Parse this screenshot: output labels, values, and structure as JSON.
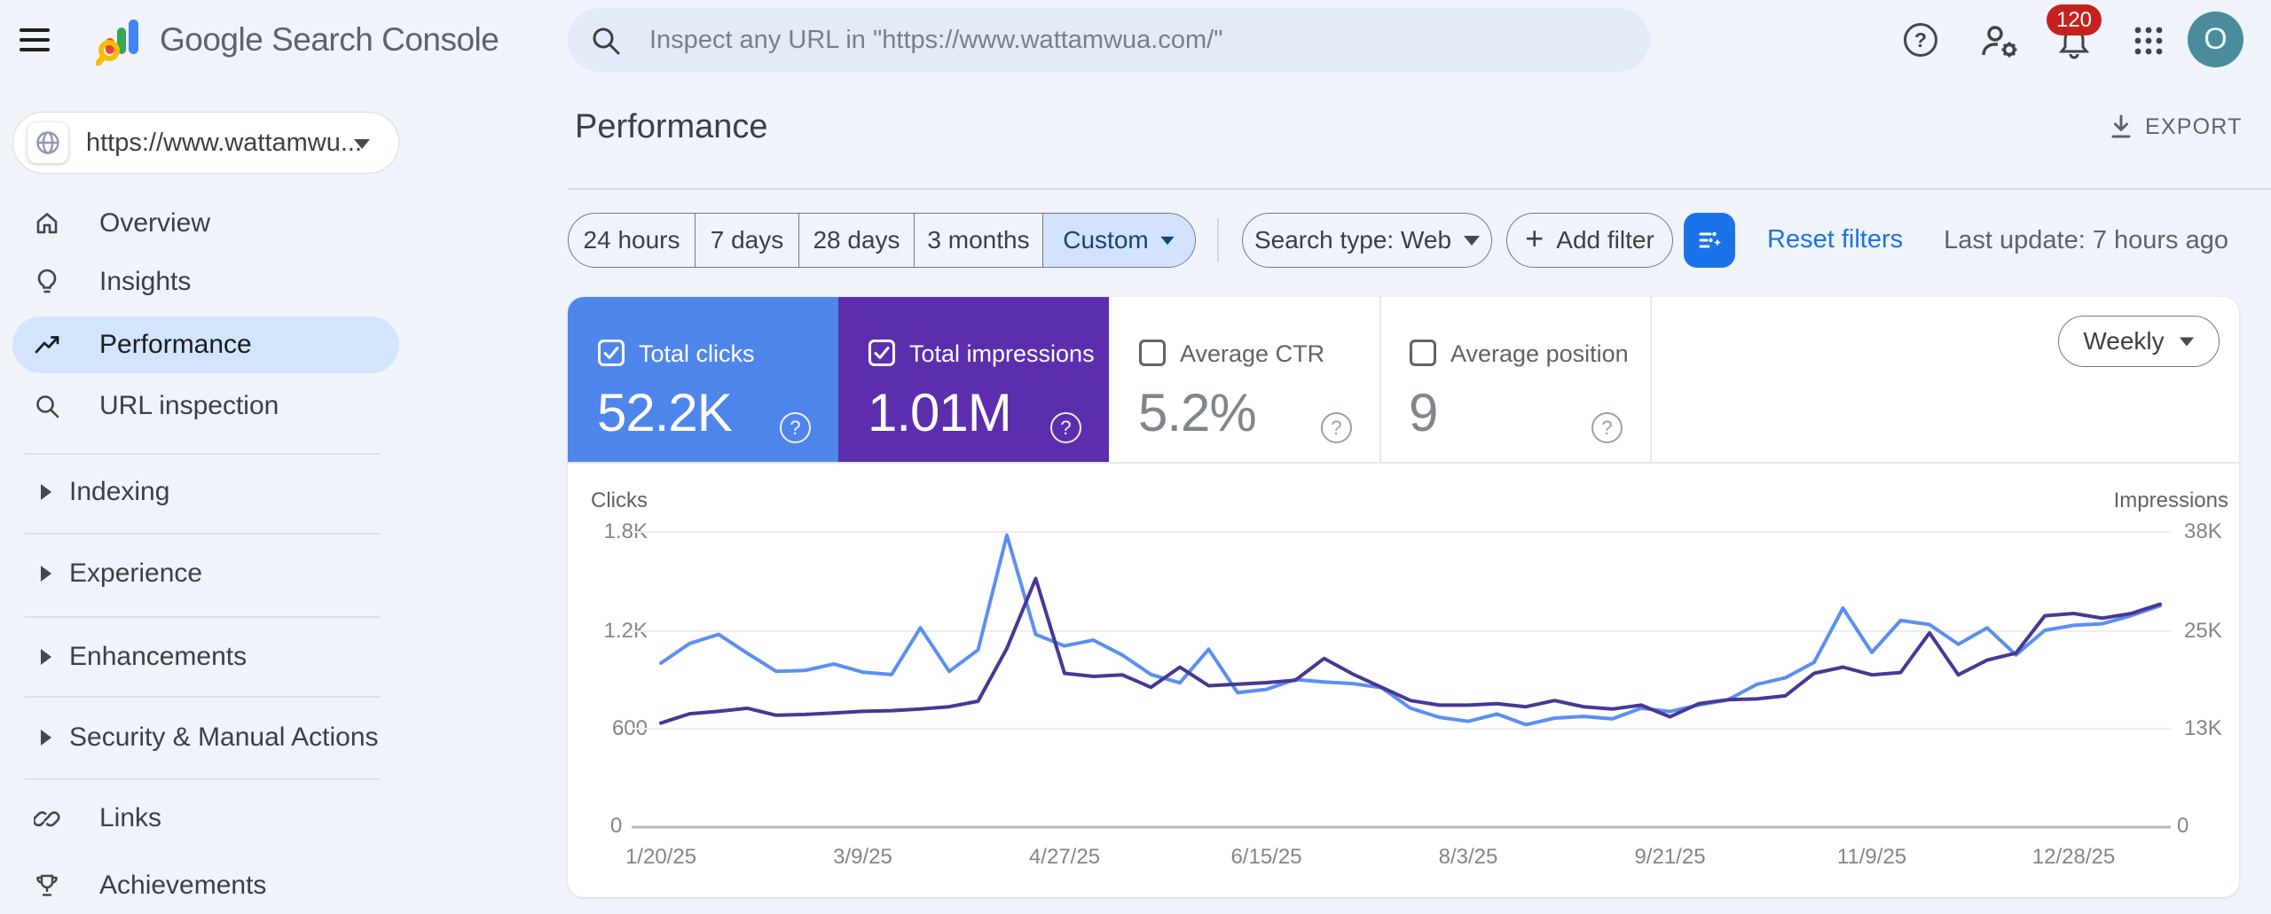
{
  "topbar": {
    "product_name": "Google Search Console",
    "search_placeholder": "Inspect any URL in \"https://www.wattamwua.com/\"",
    "notification_count": "120",
    "avatar_letter": "O"
  },
  "icons": {
    "help_glyph": "?",
    "plus_glyph": "+"
  },
  "sidebar": {
    "property_url": "https://www.wattamwu...",
    "nav": [
      {
        "label": "Overview"
      },
      {
        "label": "Insights"
      },
      {
        "label": "Performance",
        "active": true
      },
      {
        "label": "URL inspection"
      }
    ],
    "sections": [
      {
        "label": "Indexing"
      },
      {
        "label": "Experience"
      },
      {
        "label": "Enhancements"
      },
      {
        "label": "Security & Manual Actions"
      }
    ],
    "footer_nav": [
      {
        "label": "Links"
      },
      {
        "label": "Achievements"
      }
    ]
  },
  "page": {
    "title": "Performance",
    "export_label": "EXPORT"
  },
  "filters": {
    "date_ranges": [
      "24 hours",
      "7 days",
      "28 days",
      "3 months",
      "Custom"
    ],
    "selected_range": "Custom",
    "search_type_label": "Search type: Web",
    "add_filter_label": "Add filter",
    "reset_label": "Reset filters",
    "last_update": "Last update: 7 hours ago"
  },
  "metrics": [
    {
      "label": "Total clicks",
      "value": "52.2K",
      "checked": true,
      "color": "#4e86ec"
    },
    {
      "label": "Total impressions",
      "value": "1.01M",
      "checked": true,
      "color": "#5c2ead"
    },
    {
      "label": "Average CTR",
      "value": "5.2%",
      "checked": false
    },
    {
      "label": "Average position",
      "value": "9",
      "checked": false
    }
  ],
  "interval_label": "Weekly",
  "chart_data": {
    "type": "line",
    "title": "Clicks and impressions over time (weekly)",
    "grid": true,
    "legend_position": "none",
    "left_axis": {
      "title": "Clicks",
      "max": 1800,
      "ticks": [
        "1.8K",
        "1.2K",
        "600",
        "0"
      ]
    },
    "right_axis": {
      "title": "Impressions",
      "max": 38000,
      "ticks": [
        "38K",
        "25K",
        "13K",
        "0"
      ]
    },
    "x_labels": [
      "1/20/25",
      "3/9/25",
      "4/27/25",
      "6/15/25",
      "8/3/25",
      "9/21/25",
      "11/9/25",
      "12/28/25"
    ],
    "label_every": 7,
    "series": [
      {
        "name": "Clicks",
        "axis": "left",
        "color": "#5b8ff2",
        "values": [
          1000,
          1120,
          1175,
          1060,
          950,
          955,
          995,
          945,
          930,
          1215,
          950,
          1080,
          1780,
          1175,
          1105,
          1140,
          1050,
          930,
          880,
          1085,
          820,
          840,
          900,
          885,
          875,
          850,
          725,
          670,
          645,
          690,
          625,
          665,
          675,
          660,
          725,
          705,
          745,
          775,
          870,
          910,
          1005,
          1335,
          1065,
          1260,
          1235,
          1115,
          1215,
          1050,
          1200,
          1230,
          1240,
          1290,
          1350
        ]
      },
      {
        "name": "Impressions",
        "axis": "right",
        "color": "#483795",
        "values": [
          13400,
          14600,
          14900,
          15300,
          14400,
          14500,
          14700,
          14900,
          15000,
          15200,
          15500,
          16200,
          23000,
          32000,
          19800,
          19400,
          19600,
          18000,
          20600,
          18200,
          18400,
          18600,
          18900,
          21700,
          19700,
          18000,
          16300,
          15700,
          15700,
          15900,
          15500,
          16300,
          15500,
          15200,
          15700,
          14200,
          15900,
          16400,
          16500,
          16900,
          19800,
          20600,
          19600,
          19900,
          25000,
          19600,
          21500,
          22400,
          27200,
          27500,
          26900,
          27500,
          28700
        ]
      }
    ]
  }
}
